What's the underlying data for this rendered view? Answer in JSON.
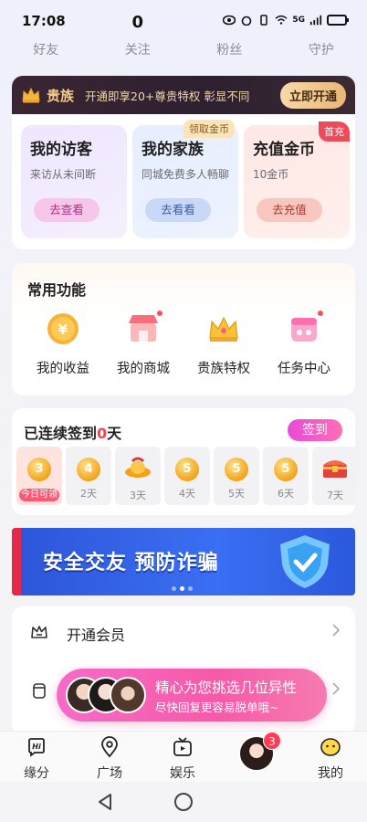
{
  "status_bar": {
    "time": "17:08",
    "network": "5G"
  },
  "stats": [
    {
      "value": "",
      "label": "好友"
    },
    {
      "value": "0",
      "label": "关注"
    },
    {
      "value": "",
      "label": "粉丝"
    },
    {
      "value": "",
      "label": "守护"
    }
  ],
  "noble": {
    "title": "贵族",
    "desc": "开通即享20+尊贵特权 彰显不同",
    "button": "立即开通"
  },
  "cards": [
    {
      "title": "我的访客",
      "subtitle": "来访从未间断",
      "button": "去查看",
      "tag": ""
    },
    {
      "title": "我的家族",
      "subtitle": "同城免费多人畅聊",
      "button": "去看看",
      "tag": "领取金币"
    },
    {
      "title": "充值金币",
      "subtitle": "10金币",
      "button": "去充值",
      "tag": "首充"
    }
  ],
  "common": {
    "title": "常用功能",
    "items": [
      {
        "label": "我的收益",
        "icon": "coin-yen-icon"
      },
      {
        "label": "我的商城",
        "icon": "shop-icon"
      },
      {
        "label": "贵族特权",
        "icon": "crown-icon"
      },
      {
        "label": "任务中心",
        "icon": "task-calendar-icon"
      }
    ]
  },
  "signin": {
    "title_prefix": "已连续签到",
    "count": "0",
    "title_suffix": "天",
    "button": "签到",
    "days": [
      {
        "coin": "3",
        "label": "今日可领",
        "type": "coin",
        "today": true
      },
      {
        "coin": "4",
        "label": "2天",
        "type": "coin",
        "today": false
      },
      {
        "coin": "",
        "label": "3天",
        "type": "gift",
        "today": false
      },
      {
        "coin": "5",
        "label": "4天",
        "type": "coin",
        "today": false
      },
      {
        "coin": "5",
        "label": "5天",
        "type": "coin",
        "today": false
      },
      {
        "coin": "5",
        "label": "6天",
        "type": "coin",
        "today": false
      },
      {
        "coin": "",
        "label": "7天",
        "type": "chest",
        "today": false
      }
    ]
  },
  "banner": {
    "text": "安全交友 预防诈骗",
    "active_dot": 1,
    "dot_count": 3
  },
  "list": [
    {
      "label": "开通会员",
      "icon": "crown-outline-icon"
    },
    {
      "label": "",
      "icon": "cup-icon"
    }
  ],
  "float_tip": {
    "line1": "精心为您挑选几位异性",
    "line2": "尽快回复更容易脱单哦~"
  },
  "tabbar": [
    {
      "label": "缘分",
      "icon": "hi-icon"
    },
    {
      "label": "广场",
      "icon": "location-icon"
    },
    {
      "label": "娱乐",
      "icon": "tv-icon"
    },
    {
      "label": "",
      "icon": "avatar-center",
      "badge": "3"
    },
    {
      "label": "我的",
      "icon": "face-icon"
    }
  ]
}
